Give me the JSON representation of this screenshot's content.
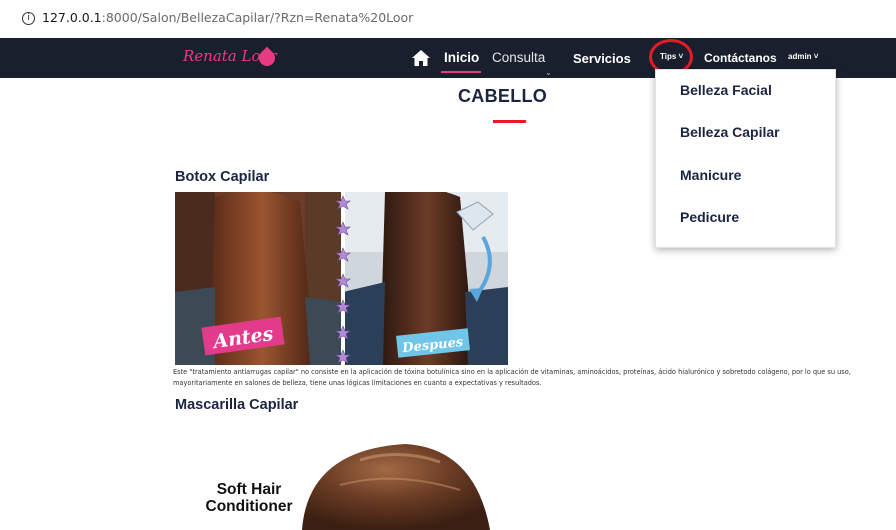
{
  "browser": {
    "info_icon": "info-circle-icon",
    "url_host": "127.0.0.1",
    "url_rest": ":8000/Salon/BellezaCapilar/?Rzn=Renata%20Loor"
  },
  "navbar": {
    "logo_text": "Renata Loor",
    "logo_icon": "drop-icon",
    "home_icon": "home-icon",
    "inicio": "Inicio",
    "consulta": "Consulta",
    "servicios": "Servicios",
    "tips": "Tips ˅",
    "contactanos": "Contáctanos",
    "admin": "admin ˅",
    "accent": "#e93b81",
    "background": "#1a1f2e"
  },
  "dropdown": {
    "items": [
      "Belleza Facial",
      "Belleza Capilar",
      "Manicure",
      "Pedicure"
    ]
  },
  "main": {
    "title": "CABELLO",
    "sections": [
      {
        "heading": "Botox Capilar",
        "image_labels": [
          "Antes",
          "Despues"
        ],
        "description": "Este \"tratamiento antiarrugas capilar\" no consiste en la aplicación de tóxina botulínica sino en la aplicación de vitaminas, aminoácidos, proteínas, ácido hialurónico y sobretodo colágeno, por lo que su uso, mayoritariamente en salones de belleza, tiene unas lógicas limitaciones en cuanto a expectativas y resultados."
      },
      {
        "heading": "Mascarilla Capilar",
        "image_text_line1": "Soft Hair",
        "image_text_line2": "Conditioner"
      }
    ]
  }
}
